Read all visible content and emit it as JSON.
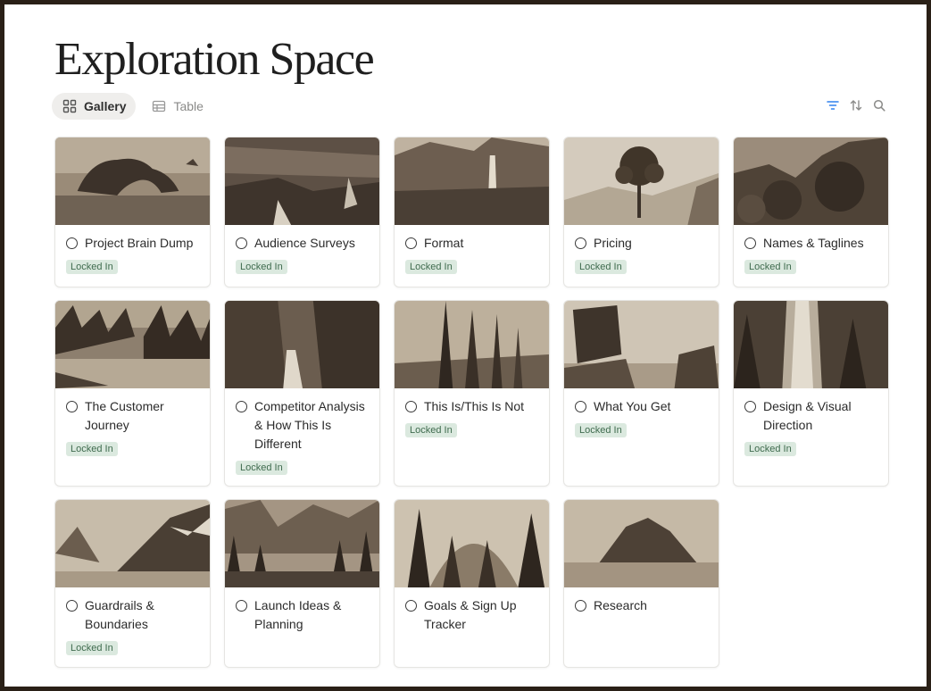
{
  "page": {
    "title": "Exploration Space"
  },
  "views": [
    {
      "label": "Gallery",
      "icon": "gallery-grid-icon",
      "active": true
    },
    {
      "label": "Table",
      "icon": "table-icon",
      "active": false
    }
  ],
  "toolbar": {
    "icons": [
      "filter-icon",
      "sort-icon",
      "search-icon"
    ],
    "accent": "#2f80ed"
  },
  "badge_colors": {
    "bg": "#dbe9df",
    "text": "#3f6b4e"
  },
  "cards": [
    {
      "name": "Project Brain Dump",
      "status": "Locked In",
      "cover": "rock-arch-photo"
    },
    {
      "name": "Audience Surveys",
      "status": "Locked In",
      "cover": "cascade-photo"
    },
    {
      "name": "Format",
      "status": "Locked In",
      "cover": "waterfall-cliff-photo"
    },
    {
      "name": "Pricing",
      "status": "Locked In",
      "cover": "joshua-tree-photo"
    },
    {
      "name": "Names & Taglines",
      "status": "Locked In",
      "cover": "boulders-photo"
    },
    {
      "name": "The Customer Journey",
      "status": "Locked In",
      "cover": "forest-river-photo"
    },
    {
      "name": "Competitor Analysis & How This Is Different",
      "status": "Locked In",
      "cover": "canyon-falls-photo"
    },
    {
      "name": "This Is/This Is Not",
      "status": "Locked In",
      "cover": "tall-pines-photo"
    },
    {
      "name": "What You Get",
      "status": "Locked In",
      "cover": "balanced-rock-photo"
    },
    {
      "name": "Design & Visual Direction",
      "status": "Locked In",
      "cover": "forest-waterfall-photo"
    },
    {
      "name": "Guardrails & Boundaries",
      "status": "Locked In",
      "cover": "mountain-lake-photo"
    },
    {
      "name": "Launch Ideas & Planning",
      "status": "",
      "cover": "valley-photo"
    },
    {
      "name": "Goals & Sign Up Tracker",
      "status": "",
      "cover": "dome-pines-photo"
    },
    {
      "name": "Research",
      "status": "",
      "cover": "butte-photo"
    }
  ]
}
